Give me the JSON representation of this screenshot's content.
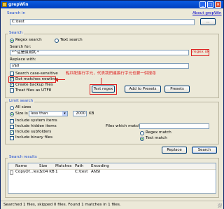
{
  "window": {
    "title": "grepWin"
  },
  "search_in": {
    "group_title": "Search in",
    "path": "C:\\test",
    "browse_label": "...",
    "about_link": "About grepWin"
  },
  "search": {
    "group_title": "Search",
    "regex_label": "Regex search",
    "text_label": "Text search",
    "search_for_label": "Search for:",
    "search_for_value": "*^這是個測試.*",
    "regex_status": "regex ok",
    "replace_with_label": "Replace with:",
    "replace_with_value": "//$0",
    "case_sensitive_label": "Search case-sensitive",
    "dot_newline_label": "Dot matches newline",
    "backup_label": "Create backup files",
    "utf8_label": "Treat files as UTF8",
    "annotation": "點匹配換行字元，代表我們連換行字元也要一併搜尋",
    "test_regex_label": "Test regex",
    "add_presets_label": "Add to Presets",
    "presets_label": "Presets"
  },
  "limit": {
    "group_title": "Limit search",
    "all_sizes_label": "All sizes",
    "size_is_label": "Size is",
    "size_op": "less than",
    "size_value": "2000",
    "size_unit": "KB",
    "system_label": "Include system items",
    "hidden_label": "Include hidden items",
    "subfolders_label": "Include subfolders",
    "binary_label": "Include binary files",
    "files_match_label": "Files which match:",
    "regex_match_label": "Regex match",
    "text_match_label": "Text match"
  },
  "actions": {
    "replace_label": "Replace",
    "search_label": "Search"
  },
  "results": {
    "group_title": "Search results",
    "columns": [
      "Name",
      "Size",
      "Matches",
      "Path",
      "Encoding"
    ],
    "rows": [
      {
        "name": "CopyOf...lex.v",
        "size": "3.04 KB",
        "matches": "1",
        "path": "C:\\test",
        "encoding": "ANSI"
      }
    ]
  },
  "status_bar": {
    "text": "Searched 1 files, skipped 0 files. Found 1 matches in 1 files."
  },
  "colors": {
    "accent_blue": "#1a4bd4",
    "annotation_red": "#dd2222",
    "check_green": "#21a121"
  }
}
